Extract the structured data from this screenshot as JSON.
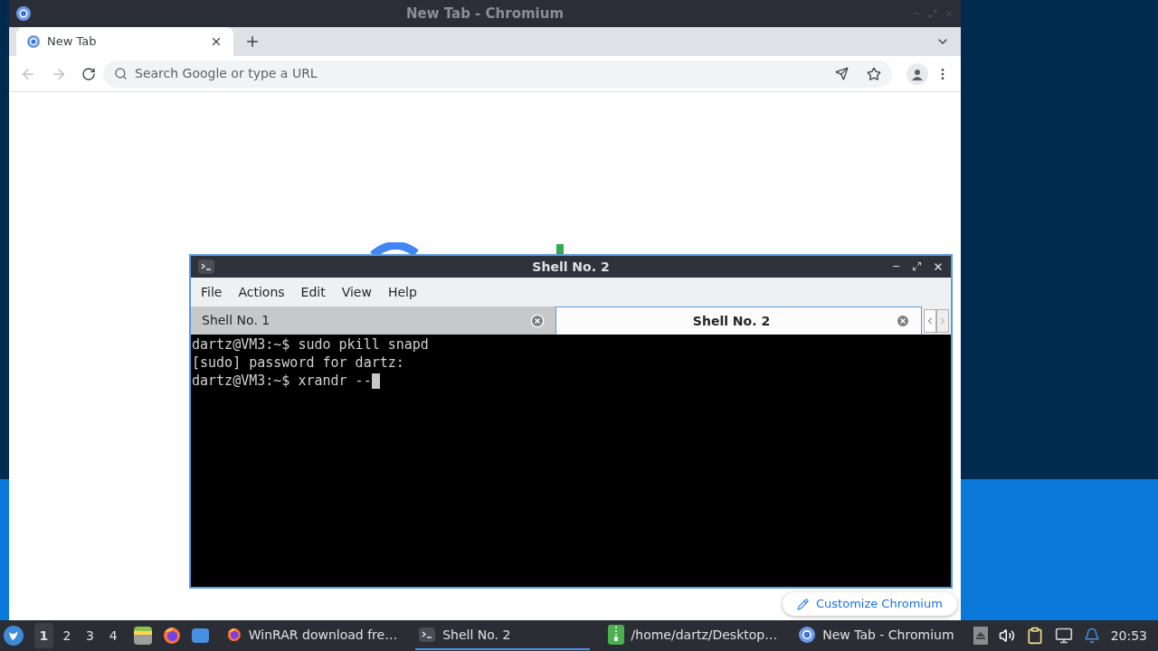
{
  "chromium": {
    "title": "New Tab - Chromium",
    "tabs": [
      {
        "label": "New Tab",
        "selected": true
      }
    ],
    "address": {
      "placeholder": "Search Google or type a URL"
    },
    "customize_button": "Customize Chromium"
  },
  "terminal": {
    "title": "Shell No. 2",
    "menu": [
      "File",
      "Actions",
      "Edit",
      "View",
      "Help"
    ],
    "tabs": [
      {
        "label": "Shell No. 1",
        "selected": false
      },
      {
        "label": "Shell No. 2",
        "selected": true
      }
    ],
    "lines": [
      "dartz@VM3:~$ sudo pkill snapd",
      "[sudo] password for dartz:",
      "dartz@VM3:~$ xrandr --"
    ]
  },
  "taskbar": {
    "workspaces": [
      {
        "label": "1",
        "selected": true
      },
      {
        "label": "2",
        "selected": false
      },
      {
        "label": "3",
        "selected": false
      },
      {
        "label": "4",
        "selected": false
      }
    ],
    "windows": [
      {
        "kind": "firefox",
        "label": "WinRAR download fre…",
        "selected": false
      },
      {
        "kind": "terminal",
        "label": "Shell No. 2",
        "selected": true
      },
      {
        "kind": "archive",
        "label": "/home/dartz/Desktop…",
        "selected": false
      },
      {
        "kind": "chromium",
        "label": "New Tab - Chromium",
        "selected": false
      }
    ],
    "clock": "20:53"
  }
}
